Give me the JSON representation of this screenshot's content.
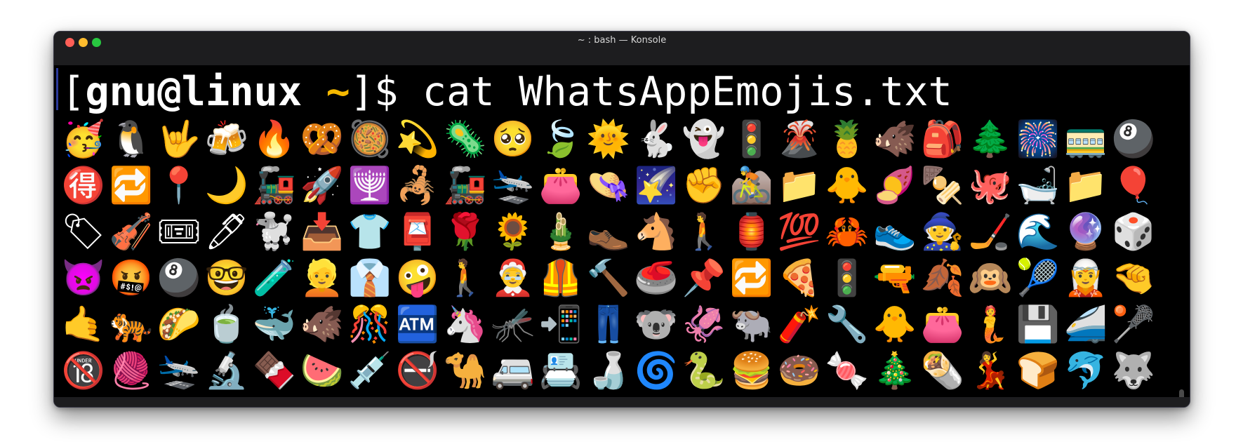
{
  "window": {
    "title": "~ : bash — Konsole",
    "traffic_lights": [
      {
        "name": "close-button",
        "color": "#ff5f57"
      },
      {
        "name": "minimize-button",
        "color": "#febc2e"
      },
      {
        "name": "maximize-button",
        "color": "#28c840"
      }
    ]
  },
  "terminal": {
    "prompt_open": "[",
    "user_host": "gnu@linux",
    "space": " ",
    "tilde": "~",
    "prompt_close": "]$ ",
    "command": "cat WhatsAppEmojis.txt",
    "tilde_color": "#f5b800",
    "background": "#000000",
    "emoji_rows": [
      [
        "🥳",
        "🐧",
        "🤟",
        "🍻",
        "🔥",
        "🥨",
        "🥘",
        "💫",
        "🦠",
        "🥺",
        "🍃",
        "🌞",
        "🐇",
        "👻",
        "🚦",
        "🌋",
        "🍍",
        "🐗",
        "🎒",
        "🌲",
        "🎆",
        "🚃",
        "🎱"
      ],
      [
        "🉐",
        "🔁",
        "📍",
        "🌙",
        "🚂",
        "🚀",
        "🕎",
        "🦂",
        "🚂",
        "🛬",
        "👛",
        "👒",
        "🌠",
        "✊",
        "🚵",
        "📁",
        "🐥",
        "🍠",
        "🍢",
        "🐙",
        "🛁",
        "📁",
        "🎈"
      ],
      [
        "🏷",
        "🎻",
        "🎟",
        "🖊",
        "🐩",
        "📥",
        "👕",
        "📮",
        "🌹",
        "🌻",
        "🎍",
        "👞",
        "🐴",
        "🚶",
        "🏮",
        "💯",
        "🦀",
        "👟",
        "🧙",
        "🏒",
        "🌊",
        "🔮",
        "🎲"
      ],
      [
        "👿",
        "🤬",
        "🎱",
        "🤓",
        "🧪",
        "👱",
        "👔",
        "🤪",
        "🚶",
        "🤶",
        "🦺",
        "🔨",
        "🥌",
        "📌",
        "🔁",
        "🍕",
        "🚦",
        "🔫",
        "🍂",
        "🙉",
        "🎾",
        "🧝",
        "🤏"
      ],
      [
        "🤙",
        "🐅",
        "🌮",
        "🍵",
        "🐳",
        "🐗",
        "🎊",
        "🏧",
        "🦄",
        "🦟",
        "📲",
        "👖",
        "🐨",
        "🦑",
        "🐃",
        "🧨",
        "🔧",
        "🐥",
        "👛",
        "🧜",
        "💾",
        "🚄",
        "🥍"
      ],
      [
        "🔞",
        "🧶",
        "🛬",
        "🔬",
        "🍫",
        "🍉",
        "💉",
        "🚭",
        "🐪",
        "🚐",
        "📇",
        "🍶",
        "🌀",
        "🐍",
        "🍔",
        "🍩",
        "🍬",
        "🎄",
        "🌯",
        "💃",
        "🍞",
        "🐬",
        "🐺"
      ]
    ]
  }
}
